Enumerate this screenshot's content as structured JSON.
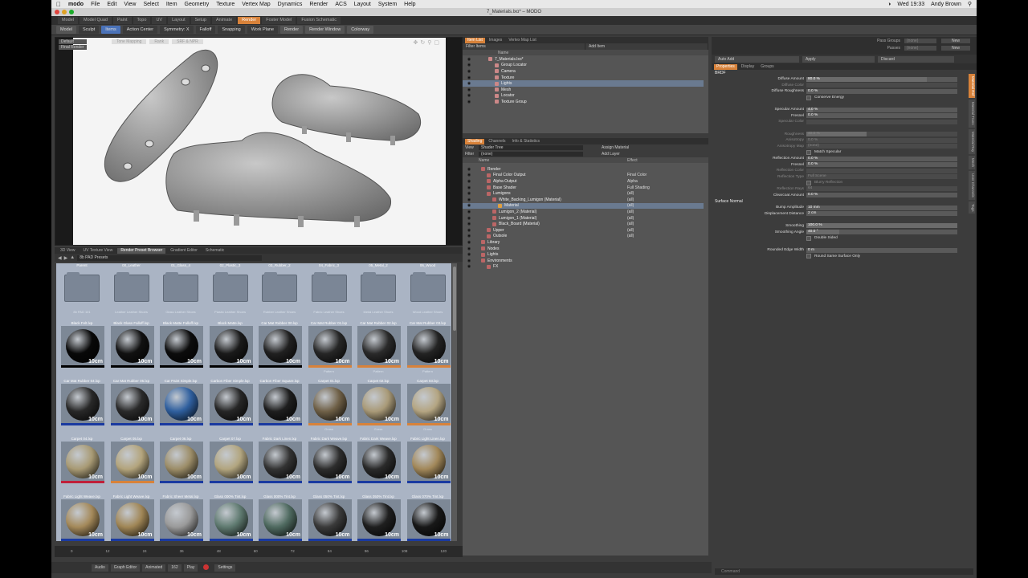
{
  "mac_menu": {
    "apple": "",
    "app": "modo",
    "items": [
      "File",
      "Edit",
      "View",
      "Select",
      "Item",
      "Geometry",
      "Texture",
      "Vertex Map",
      "Dynamics",
      "Render",
      "ACS",
      "Layout",
      "System",
      "Help"
    ],
    "clock": "Wed 19:33",
    "user": "Andy Brown"
  },
  "window": {
    "title": "7_Materials.lxo* – MODO"
  },
  "layout_tabs": [
    "Model",
    "Model Quad",
    "Paint",
    "Topo",
    "UV",
    "Layout",
    "Setup",
    "Animate",
    "Render",
    "Foster Model",
    "Fusion Schematic"
  ],
  "layout_active": "Render",
  "toolbar": {
    "model": "Model",
    "sculpt": "Sculpt",
    "items": "Items",
    "action_center": "Action Center",
    "symmetry": "Symmetry: X",
    "falloff": "Falloff",
    "snapping": "Snapping",
    "work_plane": "Work Plane",
    "render": "Render",
    "render_window": "Render Window",
    "colorway": "Colorway"
  },
  "viewport": {
    "info": [
      "Default",
      "Final Render"
    ],
    "top_labels": [
      "Tone Mapping",
      "Rank",
      "SRF & NPR"
    ]
  },
  "browser": {
    "tabs": [
      "3D View",
      "UV Texture View",
      "Render Preset Browser",
      "Gradient Editor",
      "Schematic"
    ],
    "active_tab": "Render Preset Browser",
    "path": "8b PAD Presets",
    "rows": [
      {
        "kind": "folder",
        "items": [
          {
            "label": "Parent",
            "sub": "8b PAD 101"
          },
          {
            "label": "00_Leather",
            "sub": "Leather Leather Shoes"
          },
          {
            "label": "01_Glass_4",
            "sub": "Glass Leather Shoes"
          },
          {
            "label": "02_Plastic_3",
            "sub": "Plastic Leather Shoes"
          },
          {
            "label": "03_Rubber_2",
            "sub": "Rubber Leather Shoes"
          },
          {
            "label": "04_Fabric_3",
            "sub": "Fabric Leather Shoes"
          },
          {
            "label": "05_Metal_2",
            "sub": "Metal Leather Shoes"
          },
          {
            "label": "06_Wood",
            "sub": "Wood Leather Shoes"
          }
        ]
      },
      {
        "kind": "sphere",
        "items": [
          {
            "label": "Black Felt.lxp",
            "color": "#080808",
            "bar": "#000000",
            "sub": ""
          },
          {
            "label": "Black Glass Falloff.lxp",
            "color": "#111111",
            "bar": "#000000",
            "sub": ""
          },
          {
            "label": "Black Matte Falloff.lxp",
            "color": "#0c0c0c",
            "bar": "#000000",
            "sub": ""
          },
          {
            "label": "Black Matte.lxp",
            "color": "#1a1a1a",
            "bar": "#000000",
            "sub": ""
          },
          {
            "label": "Car Mat Rubber 00.lxp",
            "color": "#202020",
            "bar": "#000000",
            "sub": ""
          },
          {
            "label": "Car Mat Rubber 01.lxp",
            "color": "#262626",
            "bar": "#d8823a",
            "sub": "Pattern"
          },
          {
            "label": "Car Mat Rubber 02.lxp",
            "color": "#2a2a2a",
            "bar": "#d8823a",
            "sub": "Pattern"
          },
          {
            "label": "Car Mat Rubber 03.lxp",
            "color": "#232323",
            "bar": "#d8823a",
            "sub": "Pattern"
          }
        ]
      },
      {
        "kind": "sphere",
        "items": [
          {
            "label": "Car Mat Rubber 04.lxp",
            "color": "#282828",
            "bar": "#1a3aa0",
            "sub": ""
          },
          {
            "label": "Car Mat Rubber 05.lxp",
            "color": "#2a2a2a",
            "bar": "#1a3aa0",
            "sub": ""
          },
          {
            "label": "Car Paint Simple.lxp",
            "color": "#2f5f9e",
            "bar": "#1a3aa0",
            "sub": ""
          },
          {
            "label": "Carbon Fiber Simple.lxp",
            "color": "#262626",
            "bar": "#1a3aa0",
            "sub": ""
          },
          {
            "label": "Carbon Fiber Square.lxp",
            "color": "#1e1e1e",
            "bar": "#1a3aa0",
            "sub": ""
          },
          {
            "label": "Carpet 01.lxp",
            "color": "#6f6047",
            "bar": "#d8823a",
            "sub": "Grass"
          },
          {
            "label": "Carpet 02.lxp",
            "color": "#a99a78",
            "bar": "#d8823a",
            "sub": "Grass"
          },
          {
            "label": "Carpet 03.lxp",
            "color": "#b4a582",
            "bar": "#d8823a",
            "sub": "Grass"
          }
        ]
      },
      {
        "kind": "sphere",
        "items": [
          {
            "label": "Carpet 04.lxp",
            "color": "#a89a74",
            "bar": "#c0203a",
            "sub": ""
          },
          {
            "label": "Carpet 05.lxp",
            "color": "#b3a47c",
            "bar": "#d8823a",
            "sub": ""
          },
          {
            "label": "Carpet 06.lxp",
            "color": "#9c8d68",
            "bar": "#1a3aa0",
            "sub": ""
          },
          {
            "label": "Carpet 07.lxp",
            "color": "#b2a57f",
            "bar": "#1a3aa0",
            "sub": ""
          },
          {
            "label": "Fabric Dark Linen.lxp",
            "color": "#333333",
            "bar": "#1a3aa0",
            "sub": ""
          },
          {
            "label": "Fabric Dark Weave.lxp",
            "color": "#2d2d2d",
            "bar": "#1a3aa0",
            "sub": ""
          },
          {
            "label": "Fabric Dark Weave.lxp",
            "color": "#2a2a2a",
            "bar": "#1a3aa0",
            "sub": ""
          },
          {
            "label": "Fabric Light Linen.lxp",
            "color": "#a2885a",
            "bar": "#1a3aa0",
            "sub": ""
          }
        ]
      },
      {
        "kind": "sphere",
        "items": [
          {
            "label": "Fabric Light Weave.lxp",
            "color": "#a4895a",
            "bar": "#1a3aa0",
            "sub": ""
          },
          {
            "label": "Fabric Light Weave.lxp",
            "color": "#a08656",
            "bar": "#1a3aa0",
            "sub": ""
          },
          {
            "label": "Fabric Sheer Metal.lxp",
            "color": "#9a9a9a",
            "bar": "#1a3aa0",
            "sub": ""
          },
          {
            "label": "Glass 000% Tint.lxp",
            "color": "#5f7a70",
            "bar": "#1a3aa0",
            "sub": ""
          },
          {
            "label": "Glass 000% Tint.lxp",
            "color": "#4f6a60",
            "bar": "#1a3aa0",
            "sub": ""
          },
          {
            "label": "Glass 050% Tint.lxp",
            "color": "#3a3a3a",
            "bar": "#1a3aa0",
            "sub": ""
          },
          {
            "label": "Glass 050% Tint.lxp",
            "color": "#1f1f1f",
            "bar": "#1a3aa0",
            "sub": ""
          },
          {
            "label": "Glass 070% Tint.lxp",
            "color": "#181818",
            "bar": "#1a3aa0",
            "sub": ""
          }
        ]
      }
    ],
    "size_badge": "10cm"
  },
  "timeline": {
    "ticks": [
      "0",
      "12",
      "24",
      "36",
      "48",
      "60",
      "72",
      "84",
      "96",
      "108",
      "120"
    ]
  },
  "transport": {
    "audio": "Audio",
    "graph": "Graph Editor",
    "mode": "Animated",
    "frame": "162",
    "play": "Play",
    "settings": "Settings"
  },
  "item_list": {
    "tabs": [
      "Item List",
      "Images",
      "Vertex Map List"
    ],
    "filter": "Filter Items",
    "add": "Add Item",
    "header": "Name",
    "rows": [
      {
        "label": "7_Materials.lxo*",
        "indent": 2,
        "sel": false
      },
      {
        "label": "Group Locator",
        "indent": 3,
        "sel": false
      },
      {
        "label": "Camera",
        "indent": 3,
        "sel": false
      },
      {
        "label": "Texture",
        "indent": 3,
        "sel": false
      },
      {
        "label": "Lights",
        "indent": 3,
        "sel": true
      },
      {
        "label": "Mesh",
        "indent": 3,
        "sel": false
      },
      {
        "label": "Locator",
        "indent": 3,
        "sel": false
      },
      {
        "label": "Texture Group",
        "indent": 3,
        "sel": false
      }
    ]
  },
  "shading": {
    "tabs": [
      "Shading",
      "Channels",
      "Info & Statistics"
    ],
    "view": "View",
    "view_val": "Shader Tree",
    "assign": "Assign Material",
    "filter": "Filter",
    "filter_val": "(none)",
    "add": "Add Layer",
    "col_name": "Name",
    "col_effect": "Effect",
    "rows": [
      {
        "label": "Render",
        "indent": 1,
        "effect": "",
        "sel": false
      },
      {
        "label": "Final Color Output",
        "indent": 2,
        "effect": "Final Color",
        "sel": false
      },
      {
        "label": "Alpha Output",
        "indent": 2,
        "effect": "Alpha",
        "sel": false
      },
      {
        "label": "Base Shader",
        "indent": 2,
        "effect": "Full Shading",
        "sel": false
      },
      {
        "label": "Lumigons",
        "indent": 2,
        "effect": "(all)",
        "sel": false
      },
      {
        "label": "White_Backing_Lumigon (Material)",
        "indent": 3,
        "effect": "(all)",
        "sel": false
      },
      {
        "label": "Material",
        "indent": 4,
        "effect": "(all)",
        "sel": true
      },
      {
        "label": "Lumigon_2 (Material)",
        "indent": 3,
        "effect": "(all)",
        "sel": false
      },
      {
        "label": "Lumigon_1 (Material)",
        "indent": 3,
        "effect": "(all)",
        "sel": false
      },
      {
        "label": "Black_Board (Material)",
        "indent": 3,
        "effect": "(all)",
        "sel": false
      },
      {
        "label": "Upper",
        "indent": 2,
        "effect": "(all)",
        "sel": false
      },
      {
        "label": "Outsole",
        "indent": 2,
        "effect": "(all)",
        "sel": false
      },
      {
        "label": "Library",
        "indent": 1,
        "effect": "",
        "sel": false
      },
      {
        "label": "Nodes",
        "indent": 1,
        "effect": "",
        "sel": false
      },
      {
        "label": "Lights",
        "indent": 1,
        "effect": "",
        "sel": false
      },
      {
        "label": "Environments",
        "indent": 1,
        "effect": "",
        "sel": false
      },
      {
        "label": "FX",
        "indent": 2,
        "effect": "",
        "sel": false
      }
    ]
  },
  "properties": {
    "pass_groups": "Pass Groups",
    "pass_val": "(none)",
    "passes": "Passes",
    "passes_val": "(none)",
    "new": "New",
    "auto_add": "Auto Add",
    "apply": "Apply",
    "discard": "Discard",
    "tabs": [
      "Properties",
      "Display",
      "Groups"
    ],
    "section_brdf": "BRDF",
    "rows": [
      {
        "label": "Diffuse Amount",
        "value": "80.0 %",
        "fill": 0.8,
        "dim": false
      },
      {
        "label": "Diffuse Color",
        "value": "",
        "fill": 0,
        "dim": true
      },
      {
        "label": "Diffuse Roughness",
        "value": "0.0 %",
        "fill": 0,
        "dim": false
      },
      {
        "label": "Conserve Energy",
        "value": "",
        "fill": 0,
        "dim": false,
        "check": true
      },
      {
        "label": "",
        "value": "",
        "fill": 0,
        "dim": false
      },
      {
        "label": "Specular Amount",
        "value": "4.0 %",
        "fill": 0.04,
        "dim": false
      },
      {
        "label": "Fresnel",
        "value": "0.0 %",
        "fill": 0,
        "dim": false
      },
      {
        "label": "Specular Color",
        "value": "",
        "fill": 0,
        "dim": true
      },
      {
        "label": "",
        "value": "",
        "fill": 0,
        "dim": false
      },
      {
        "label": "Roughness",
        "value": "40.0 %",
        "fill": 0.4,
        "dim": true
      },
      {
        "label": "Anisotropy",
        "value": "0.0 %",
        "fill": 0,
        "dim": true
      },
      {
        "label": "Anisotropy Map",
        "value": "(none)",
        "fill": 0,
        "dim": true
      },
      {
        "label": "Match Specular",
        "value": "",
        "fill": 0,
        "dim": false,
        "check": true
      },
      {
        "label": "Reflection Amount",
        "value": "0.0 %",
        "fill": 0,
        "dim": false
      },
      {
        "label": "Fresnel",
        "value": "0.0 %",
        "fill": 0,
        "dim": false
      },
      {
        "label": "Reflection Color",
        "value": "",
        "fill": 0,
        "dim": true
      },
      {
        "label": "Reflection Type",
        "value": "Full Scene",
        "fill": 0,
        "dim": true
      },
      {
        "label": "Blurry Reflection",
        "value": "",
        "fill": 0,
        "dim": true,
        "check": true
      },
      {
        "label": "Reflection Rays",
        "value": "64",
        "fill": 0,
        "dim": true
      },
      {
        "label": "Clearcoat Amount",
        "value": "0.0 %",
        "fill": 0,
        "dim": false
      }
    ],
    "section_surface": "Surface Normal",
    "rows2": [
      {
        "label": "Bump Amplitude",
        "value": "10 mm",
        "fill": 0,
        "dim": false
      },
      {
        "label": "Displacement Distance",
        "value": "2 cm",
        "fill": 0,
        "dim": false
      },
      {
        "label": "",
        "value": "",
        "fill": 0,
        "dim": false
      },
      {
        "label": "Smoothing",
        "value": "100.0 %",
        "fill": 1.0,
        "dim": false
      },
      {
        "label": "Smoothing Angle",
        "value": "40.0 °",
        "fill": 0.22,
        "dim": false
      },
      {
        "label": "Double Sided",
        "value": "",
        "fill": 0,
        "dim": false,
        "check": true
      },
      {
        "label": "",
        "value": "",
        "fill": 0,
        "dim": false
      },
      {
        "label": "Rounded Edge Width",
        "value": "0 m",
        "fill": 0,
        "dim": false
      },
      {
        "label": "Round Same Surface Only",
        "value": "",
        "fill": 0,
        "dim": false,
        "check": true
      }
    ],
    "side_tabs": [
      "Material Ref",
      "Material Trans",
      "Material Ray",
      "Mesh",
      "User Channels",
      "Tags"
    ],
    "command": "Command"
  }
}
